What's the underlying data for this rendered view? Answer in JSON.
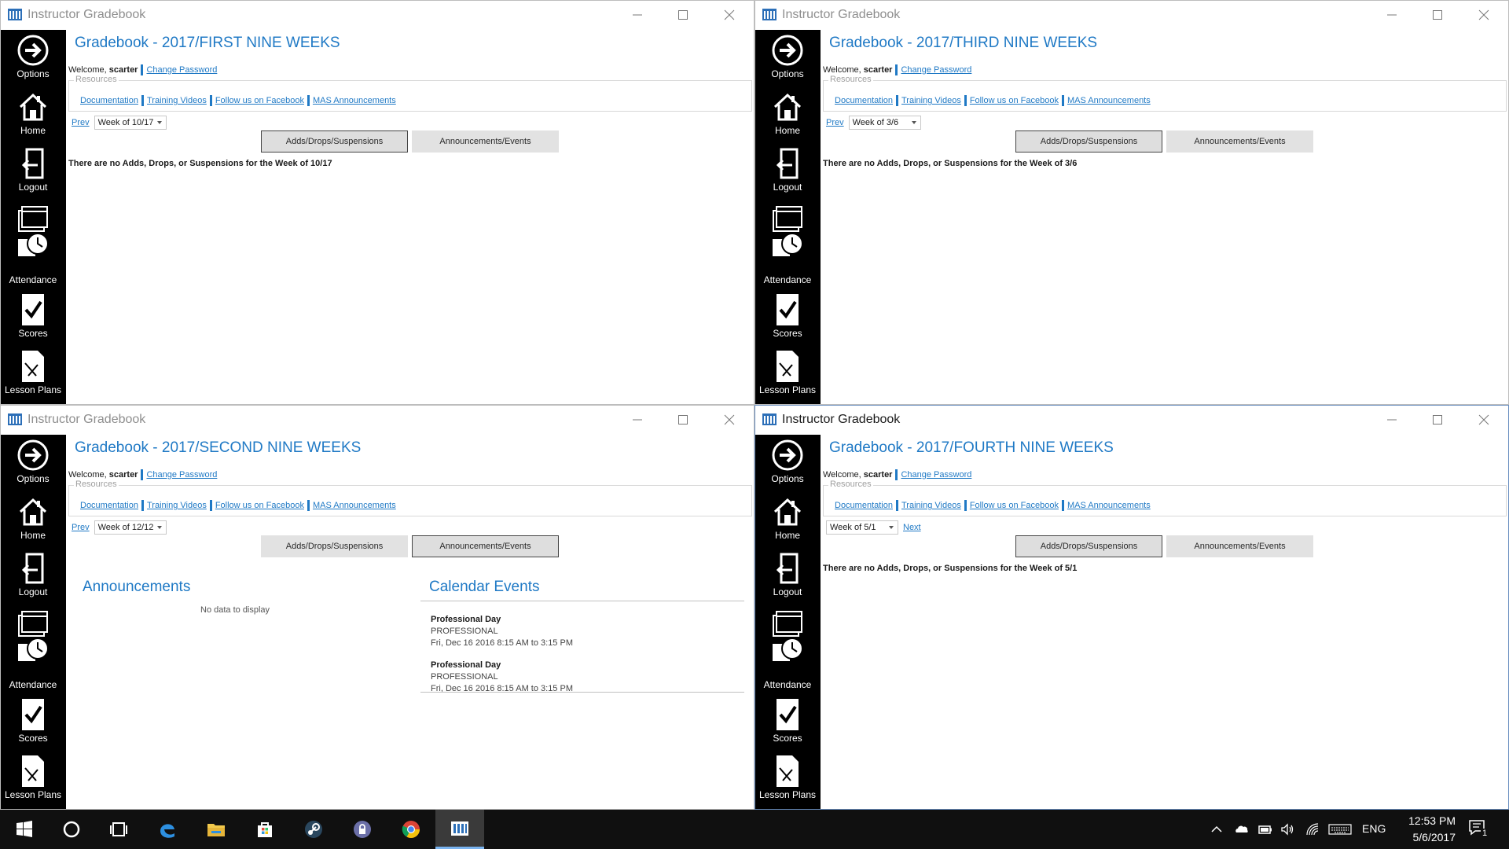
{
  "app_title": "Instructor Gradebook",
  "welcome_prefix": "Welcome,",
  "username": "scarter",
  "change_password": "Change Password",
  "resources_label": "Resources",
  "resource_links": [
    "Documentation",
    "Training Videos",
    "Follow us on Facebook",
    "MAS Announcements"
  ],
  "nav": {
    "options": "Options",
    "home": "Home",
    "logout": "Logout",
    "attendance": "Attendance",
    "scores": "Scores",
    "lesson_plans": "Lesson Plans"
  },
  "tabs": {
    "adds": "Adds/Drops/Suspensions",
    "announcements": "Announcements/Events"
  },
  "windows": [
    {
      "title": "Gradebook - 2017/FIRST NINE WEEKS",
      "prev": "Prev",
      "week": "Week of 10/17",
      "next": "",
      "message": "There are no Adds, Drops, or Suspensions for the Week of 10/17",
      "active_tab": "adds",
      "focused": false
    },
    {
      "title": "Gradebook - 2017/THIRD NINE WEEKS",
      "prev": "Prev",
      "week": "Week of 3/6",
      "next": "",
      "message": "There are no Adds, Drops, or Suspensions for the Week of 3/6",
      "active_tab": "adds",
      "focused": false
    },
    {
      "title": "Gradebook - 2017/SECOND NINE WEEKS",
      "prev": "Prev",
      "week": "Week of 12/12",
      "next": "",
      "message": "",
      "active_tab": "announcements",
      "focused": false,
      "announcements": {
        "title": "Announcements",
        "empty": "No data to display"
      },
      "calendar": {
        "title": "Calendar Events",
        "events": [
          {
            "name": "Professional Day",
            "type": "PROFESSIONAL",
            "time": "Fri, Dec 16 2016 8:15 AM to 3:15 PM"
          },
          {
            "name": "Professional Day",
            "type": "PROFESSIONAL",
            "time": "Fri, Dec 16 2016 8:15 AM to 3:15 PM"
          }
        ]
      }
    },
    {
      "title": "Gradebook - 2017/FOURTH NINE WEEKS",
      "prev": "",
      "week": "Week of 5/1",
      "next": "Next",
      "message": "There are no Adds, Drops, or Suspensions for the Week of 5/1",
      "active_tab": "adds",
      "focused": true
    }
  ],
  "taskbar": {
    "language": "ENG",
    "time": "12:53 PM",
    "date": "5/6/2017",
    "notification_count": "1",
    "icons": [
      "windows-start-icon",
      "cortana-search-icon",
      "task-view-icon",
      "edge-icon",
      "file-explorer-icon",
      "store-icon",
      "steam-icon",
      "vpn-lock-icon",
      "chrome-icon",
      "gradebook-app-icon"
    ],
    "tray_icons": [
      "chevron-up-icon",
      "onedrive-icon",
      "battery-icon",
      "volume-icon",
      "wifi-icon",
      "keyboard-icon"
    ]
  },
  "colors": {
    "accent": "#1f79c5",
    "sidebar": "#000000",
    "taskbar": "#101010"
  }
}
